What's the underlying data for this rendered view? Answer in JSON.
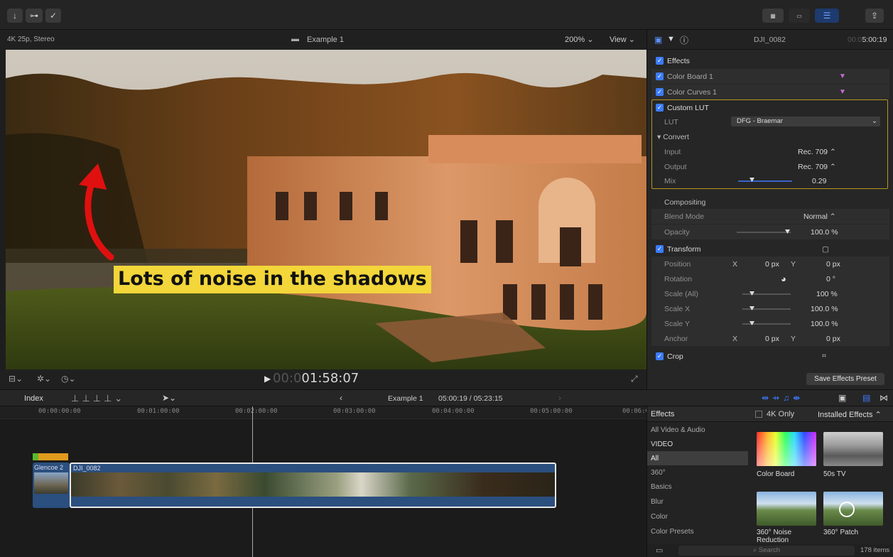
{
  "toolbar": {
    "icons": [
      "import-icon",
      "keywords-icon",
      "analyze-icon",
      "browser-toggle-icon",
      "timeline-toggle-icon",
      "inspector-toggle-icon",
      "share-icon"
    ]
  },
  "viewer": {
    "format": "4K 25p, Stereo",
    "project_title": "Example 1",
    "zoom": "200%",
    "view_menu": "View",
    "annotation": "Lots of noise in the shadows",
    "timecode_dim": "00:0",
    "timecode": "01:58:07"
  },
  "inspector": {
    "clip_name": "DJI_0082",
    "duration_dim": "00:0",
    "duration": "5:00:19",
    "effects_label": "Effects",
    "effects": [
      "Color Board 1",
      "Color Curves 1",
      "Custom LUT"
    ],
    "lut_label": "LUT",
    "lut_value": "DFG - Braemar",
    "convert_label": "Convert",
    "input_label": "Input",
    "input_value": "Rec. 709 ⌃",
    "output_label": "Output",
    "output_value": "Rec. 709 ⌃",
    "mix_label": "Mix",
    "mix_value": "0.29",
    "mix_fraction": 0.29,
    "compositing_label": "Compositing",
    "blend_label": "Blend Mode",
    "blend_value": "Normal ⌃",
    "opacity_label": "Opacity",
    "opacity_value": "100.0 %",
    "transform_label": "Transform",
    "position_label": "Position",
    "x_label": "X",
    "y_label": "Y",
    "pos_x": "0 px",
    "pos_y": "0 px",
    "rotation_label": "Rotation",
    "rotation_value": "0 °",
    "scale_all_label": "Scale (All)",
    "scale_all_value": "100 %",
    "scale_x_label": "Scale X",
    "scale_x_value": "100.0 %",
    "scale_y_label": "Scale Y",
    "scale_y_value": "100.0 %",
    "anchor_label": "Anchor",
    "anchor_x": "0 px",
    "anchor_y": "0 px",
    "crop_label": "Crop",
    "save_preset": "Save Effects Preset"
  },
  "timeline": {
    "index_label": "Index",
    "project": "Example 1",
    "position": "05:00:19 / 05:23:15",
    "ruler": [
      "00:00:00:00",
      "00:01:00:00",
      "00:02:00:00",
      "00:03:00:00",
      "00:04:00:00",
      "00:05:00:00",
      "00:06:0"
    ],
    "clip_a": "Glencoe 2",
    "clip_b": "DJI_0082"
  },
  "effects_browser": {
    "title": "Effects",
    "only_4k": "4K Only",
    "installed": "Installed Effects ⌃",
    "categories": [
      "All Video & Audio",
      "VIDEO",
      "All",
      "360°",
      "Basics",
      "Blur",
      "Color",
      "Color Presets"
    ],
    "items": [
      "Color Board",
      "50s TV",
      "360° Noise Reduction",
      "360° Patch"
    ],
    "search_placeholder": "Search",
    "count": "178 items"
  }
}
